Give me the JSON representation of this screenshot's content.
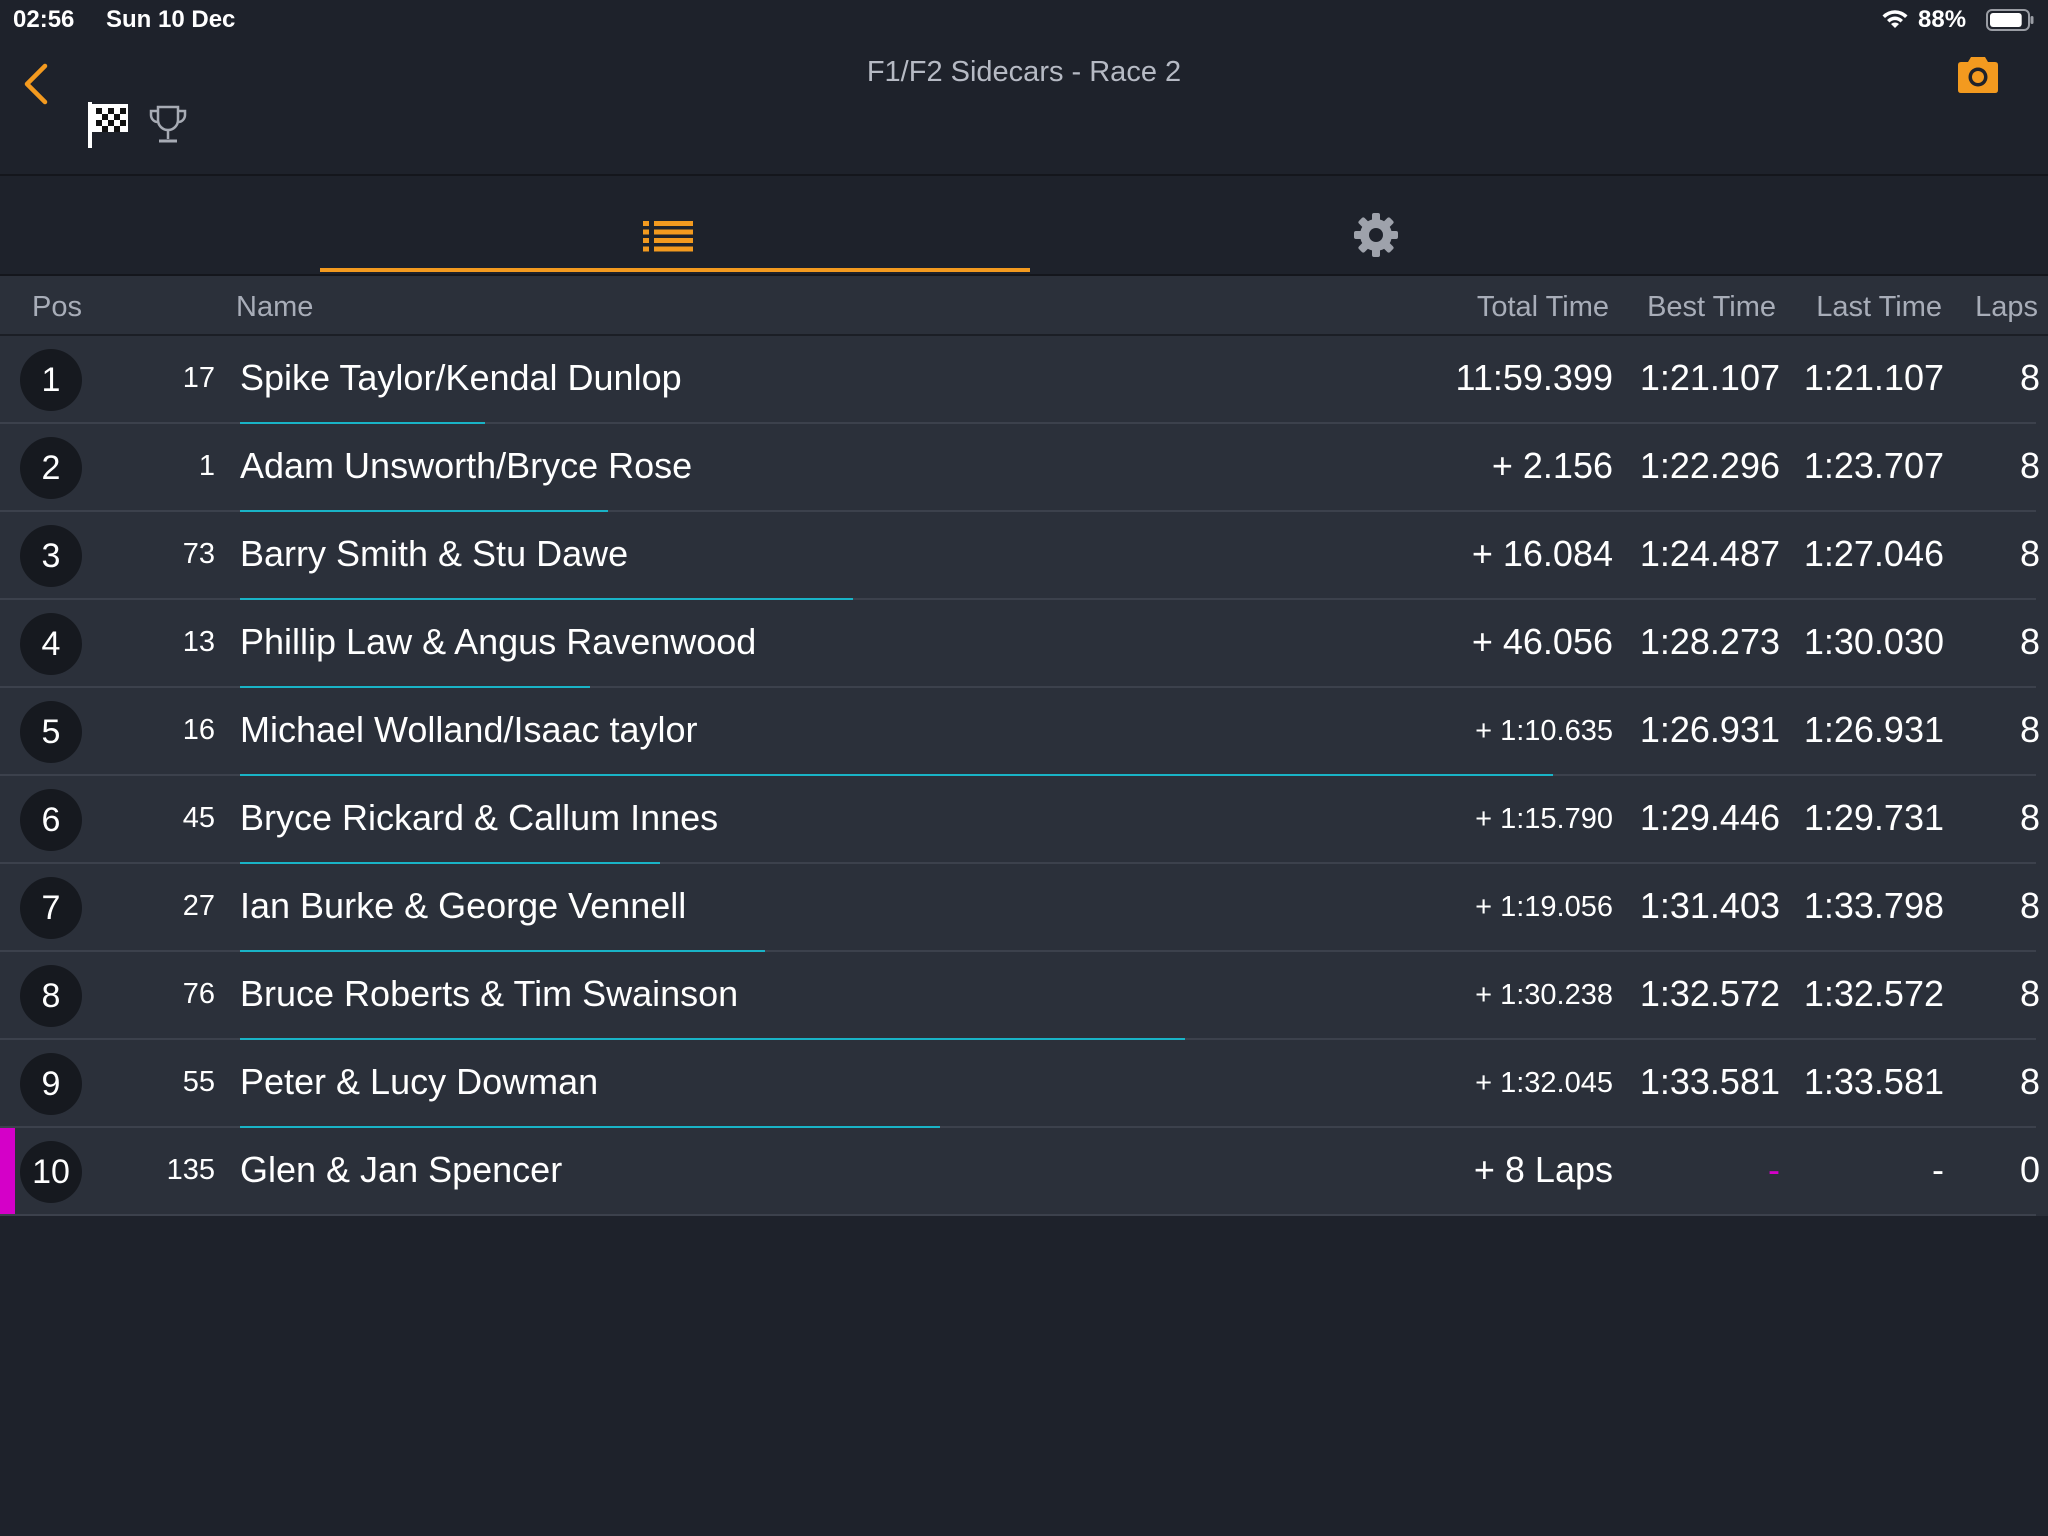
{
  "status_bar": {
    "time": "02:56",
    "date": "Sun 10 Dec",
    "battery": "88%",
    "battery_level": 0.88
  },
  "header": {
    "title": "F1/F2 Sidecars - Race 2",
    "accent_color": "#f39a1f"
  },
  "table": {
    "headers": {
      "pos": "Pos",
      "name": "Name",
      "total": "Total Time",
      "best": "Best Time",
      "last": "Last Time",
      "laps": "Laps"
    },
    "rows": [
      {
        "pos": "1",
        "num": "17",
        "name": "Spike Taylor/Kendal Dunlop",
        "total": "11:59.399",
        "best": "1:21.107",
        "last": "1:21.107",
        "laps": "8",
        "lap_progress": 0.14
      },
      {
        "pos": "2",
        "num": "1",
        "name": "Adam Unsworth/Bryce Rose",
        "total": "+ 2.156",
        "best": "1:22.296",
        "last": "1:23.707",
        "laps": "8",
        "lap_progress": 0.21
      },
      {
        "pos": "3",
        "num": "73",
        "name": "Barry Smith & Stu Dawe",
        "total": "+ 16.084",
        "best": "1:24.487",
        "last": "1:27.046",
        "laps": "8",
        "lap_progress": 0.35
      },
      {
        "pos": "4",
        "num": "13",
        "name": "Phillip Law & Angus Ravenwood",
        "total": "+ 46.056",
        "best": "1:28.273",
        "last": "1:30.030",
        "laps": "8",
        "lap_progress": 0.2
      },
      {
        "pos": "5",
        "num": "16",
        "name": "Michael Wolland/Isaac taylor",
        "total": "+ 1:10.635",
        "best": "1:26.931",
        "last": "1:26.931",
        "laps": "8",
        "lap_progress": 0.75
      },
      {
        "pos": "6",
        "num": "45",
        "name": "Bryce Rickard & Callum Innes",
        "total": "+ 1:15.790",
        "best": "1:29.446",
        "last": "1:29.731",
        "laps": "8",
        "lap_progress": 0.24
      },
      {
        "pos": "7",
        "num": "27",
        "name": "Ian Burke & George Vennell",
        "total": "+ 1:19.056",
        "best": "1:31.403",
        "last": "1:33.798",
        "laps": "8",
        "lap_progress": 0.3
      },
      {
        "pos": "8",
        "num": "76",
        "name": "Bruce Roberts & Tim Swainson",
        "total": "+ 1:30.238",
        "best": "1:32.572",
        "last": "1:32.572",
        "laps": "8",
        "lap_progress": 0.54
      },
      {
        "pos": "9",
        "num": "55",
        "name": "Peter & Lucy Dowman",
        "total": "+ 1:32.045",
        "best": "1:33.581",
        "last": "1:33.581",
        "laps": "8",
        "lap_progress": 0.4
      },
      {
        "pos": "10",
        "num": "135",
        "name": "Glen & Jan Spencer",
        "total": "+ 8 Laps",
        "best": "-",
        "last": "-",
        "laps": "0",
        "lap_progress": 0
      }
    ]
  },
  "colors": {
    "background": "#1e222b",
    "row_background": "#2b303a",
    "progress": "#19b3c6",
    "flag_stripe": "#d400c8"
  }
}
